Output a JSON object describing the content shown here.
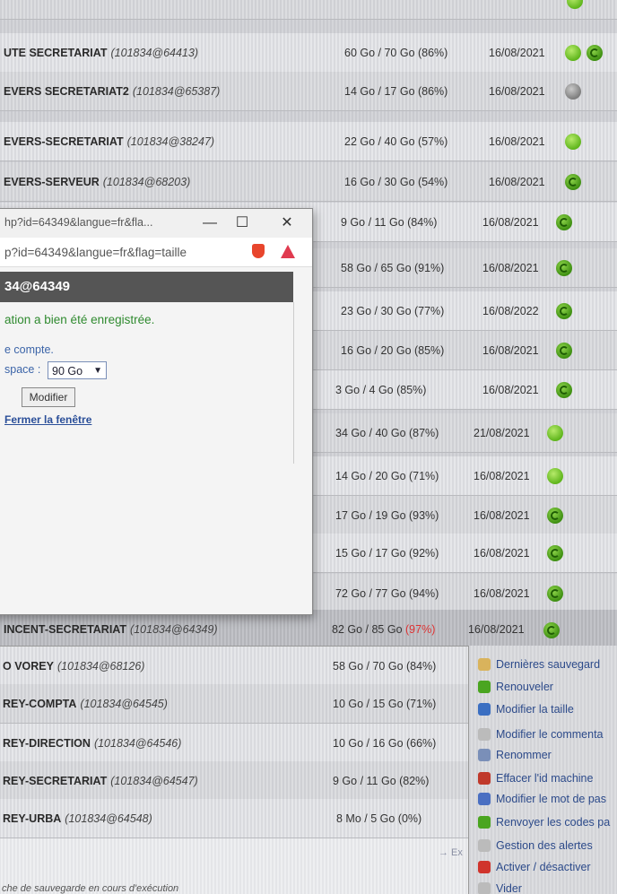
{
  "top_rows": [
    {
      "name": "UTE SECRETARIAT",
      "id": "(101834@64413)",
      "usage": "60 Go / 70 Go (86%)",
      "date": "16/08/2021",
      "status": "green-renew"
    },
    {
      "name": "EVERS SECRETARIAT2",
      "id": "(101834@65387)",
      "usage": "14 Go / 17 Go (86%)",
      "date": "16/08/2021",
      "status": "grey"
    },
    {
      "name": "EVERS-SECRETARIAT",
      "id": "(101834@38247)",
      "usage": "22 Go / 40 Go (57%)",
      "date": "16/08/2021",
      "status": "green"
    },
    {
      "name": "EVERS-SERVEUR",
      "id": "(101834@68203)",
      "usage": "16 Go / 30 Go (54%)",
      "date": "16/08/2021",
      "status": "renew"
    },
    {
      "name": "",
      "id": "",
      "usage": "9 Go / 11 Go (84%)",
      "date": "16/08/2021",
      "status": "renew"
    },
    {
      "name": "",
      "id": "",
      "usage": "58 Go / 65 Go (91%)",
      "date": "16/08/2021",
      "status": "renew"
    },
    {
      "name": "",
      "id": "",
      "usage": "23 Go / 30 Go (77%)",
      "date": "16/08/2022",
      "status": "renew"
    },
    {
      "name": "",
      "id": "",
      "usage": "16 Go / 20 Go (85%)",
      "date": "16/08/2021",
      "status": "renew"
    },
    {
      "name": "",
      "id": "",
      "usage": "3 Go / 4 Go (85%)",
      "date": "16/08/2021",
      "status": "renew"
    },
    {
      "name": "",
      "id": "",
      "usage": "34 Go / 40 Go (87%)",
      "date": "21/08/2021",
      "status": "green"
    },
    {
      "name": "",
      "id": "",
      "usage": "14 Go / 20 Go (71%)",
      "date": "16/08/2021",
      "status": "green"
    },
    {
      "name": "",
      "id": "",
      "usage": "17 Go / 19 Go (93%)",
      "date": "16/08/2021",
      "status": "renew"
    },
    {
      "name": "",
      "id": "",
      "usage": "15 Go / 17 Go (92%)",
      "date": "16/08/2021",
      "status": "renew"
    },
    {
      "name": "",
      "id": "",
      "usage": "72 Go / 77 Go (94%)",
      "date": "16/08/2021",
      "status": "renew"
    }
  ],
  "selected_row": {
    "name": "INCENT-SECRETARIAT",
    "id": "(101834@64349)",
    "usage_main": "82 Go / 85 Go",
    "usage_pct": "(97%)",
    "date": "16/08/2021"
  },
  "lower_rows": [
    {
      "name": "O VOREY",
      "id": "(101834@68126)",
      "usage": "58 Go / 70 Go (84%)"
    },
    {
      "name": "REY-COMPTA",
      "id": "(101834@64545)",
      "usage": "10 Go / 15 Go (71%)"
    },
    {
      "name": "REY-DIRECTION",
      "id": "(101834@64546)",
      "usage": "10 Go / 16 Go (66%)"
    },
    {
      "name": "REY-SECRETARIAT",
      "id": "(101834@64547)",
      "usage": "9 Go / 11 Go (82%)"
    },
    {
      "name": "REY-URBA",
      "id": "(101834@64548)",
      "usage": "8 Mo / 5 Go (0%)"
    }
  ],
  "context_menu": [
    {
      "label": "Dernières sauvegard",
      "icon": "folder-icon",
      "color": "#d9b35c"
    },
    {
      "label": "Renouveler",
      "icon": "renew-icon",
      "color": "#4aa520"
    },
    {
      "label": "Modifier la taille",
      "icon": "resize-icon",
      "color": "#3b6fc2"
    },
    {
      "label": "Modifier le commenta",
      "icon": "comment-icon",
      "color": "#bbbbbb"
    },
    {
      "label": "Renommer",
      "icon": "rename-icon",
      "color": "#7a8fb8"
    },
    {
      "label": "Effacer l'id machine",
      "icon": "erase-icon",
      "color": "#c0392b"
    },
    {
      "label": "Modifier le mot de pas",
      "icon": "key-icon",
      "color": "#4a6fc2"
    },
    {
      "label": "Renvoyer les codes pa",
      "icon": "send-icon",
      "color": "#4aa520"
    },
    {
      "label": "Gestion des alertes",
      "icon": "alert-icon",
      "color": "#bbbbbb"
    },
    {
      "label": "Activer / désactiver",
      "icon": "power-icon",
      "color": "#d0342c"
    },
    {
      "label": "Vider",
      "icon": "empty-icon",
      "color": "#bbbbbb"
    }
  ],
  "popup": {
    "title": "hp?id=64349&langue=fr&fla...",
    "url": "p?id=64349&langue=fr&flag=taille",
    "header": "34@64349",
    "message": "ation a bien été enregistrée.",
    "label_account": "e compte.",
    "label_space": "space :",
    "space_value": "90 Go",
    "modify_button": "Modifier",
    "close_link": "Fermer la fenêtre",
    "min_glyph": "—",
    "max_glyph": "☐",
    "close_glyph": "✕"
  },
  "footer": "che de sauvegarde en cours d'exécution",
  "expand_text": "→ Ex"
}
